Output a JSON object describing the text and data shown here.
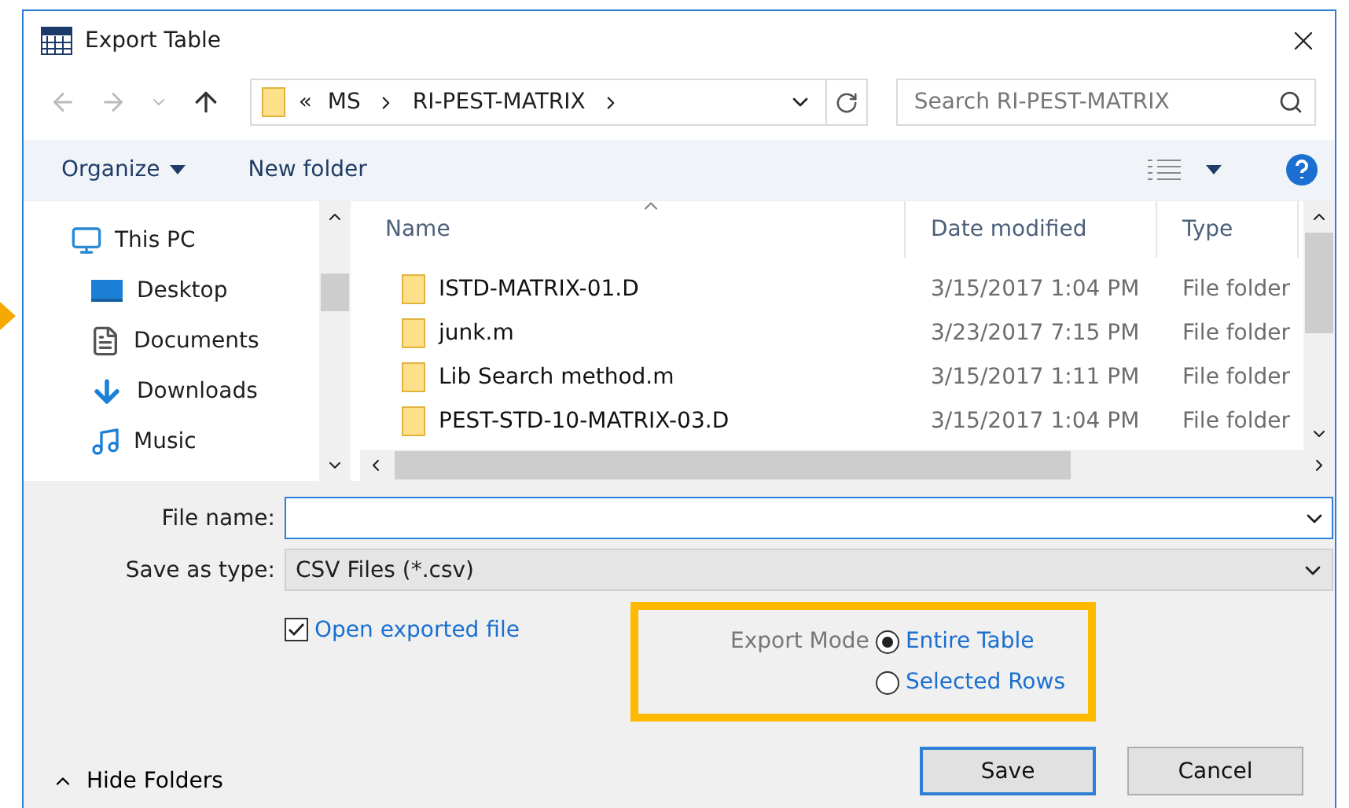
{
  "window": {
    "title": "Export Table"
  },
  "address": {
    "overflow": "«",
    "crumbs": [
      "MS",
      "RI-PEST-MATRIX"
    ]
  },
  "search": {
    "placeholder": "Search RI-PEST-MATRIX"
  },
  "toolbar": {
    "organize": "Organize",
    "new_folder": "New folder"
  },
  "nav_items": [
    {
      "label": "This PC",
      "kind": "pc"
    },
    {
      "label": "Desktop",
      "kind": "desktop"
    },
    {
      "label": "Documents",
      "kind": "documents"
    },
    {
      "label": "Downloads",
      "kind": "downloads"
    },
    {
      "label": "Music",
      "kind": "music"
    }
  ],
  "columns": [
    "Name",
    "Date modified",
    "Type"
  ],
  "files": [
    {
      "name": "ISTD-MATRIX-01.D",
      "date": "3/15/2017 1:04 PM",
      "type": "File folder"
    },
    {
      "name": "junk.m",
      "date": "3/23/2017 7:15 PM",
      "type": "File folder"
    },
    {
      "name": "Lib Search method.m",
      "date": "3/15/2017 1:11 PM",
      "type": "File folder"
    },
    {
      "name": "PEST-STD-10-MATRIX-03.D",
      "date": "3/15/2017 1:04 PM",
      "type": "File folder"
    }
  ],
  "file_name": {
    "label": "File name:"
  },
  "save_type": {
    "label": "Save as type:",
    "value": "CSV Files (*.csv)"
  },
  "open_exported": {
    "label": "Open exported file",
    "checked": true
  },
  "export_mode": {
    "label": "Export Mode",
    "options": [
      {
        "label": "Entire Table",
        "selected": true
      },
      {
        "label": "Selected Rows",
        "selected": false
      }
    ]
  },
  "hide_folders": "Hide Folders",
  "buttons": [
    {
      "label": "Save",
      "default": true
    },
    {
      "label": "Cancel",
      "default": false
    }
  ]
}
